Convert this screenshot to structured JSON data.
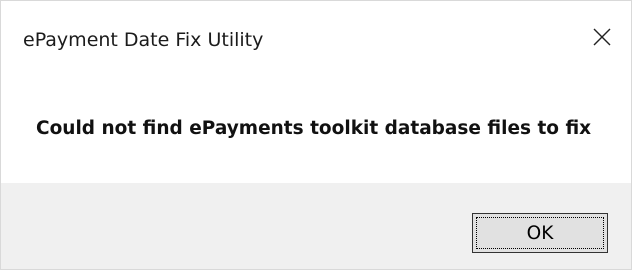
{
  "window": {
    "title": "ePayment Date Fix Utility",
    "close_icon": "close-icon"
  },
  "message": {
    "text": "Could not find ePayments toolkit database files to fix"
  },
  "buttons": {
    "ok_label": "OK"
  },
  "colors": {
    "footer_background": "#f0f0f0",
    "button_background": "#e1e1e1",
    "window_background": "#ffffff"
  }
}
